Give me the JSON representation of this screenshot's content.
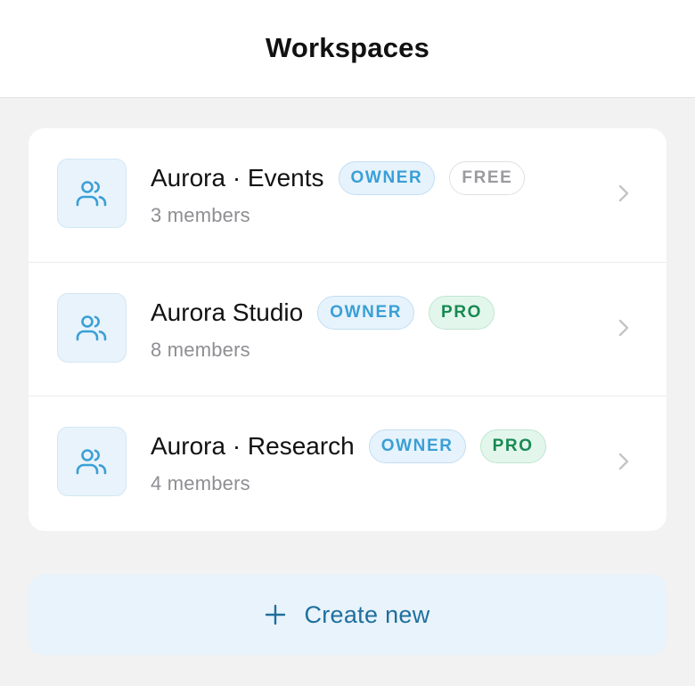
{
  "header": {
    "title": "Workspaces"
  },
  "workspaces": [
    {
      "name": "Aurora · Events",
      "members": "3 members",
      "role_badge": "OWNER",
      "plan_badge": "FREE",
      "plan_kind": "free",
      "icon": "users-icon"
    },
    {
      "name": "Aurora Studio",
      "members": "8 members",
      "role_badge": "OWNER",
      "plan_badge": "PRO",
      "plan_kind": "pro",
      "icon": "users-icon"
    },
    {
      "name": "Aurora · Research",
      "members": "4 members",
      "role_badge": "OWNER",
      "plan_badge": "PRO",
      "plan_kind": "pro",
      "icon": "users-icon"
    }
  ],
  "actions": {
    "create_label": "Create new",
    "create_icon": "plus-icon"
  },
  "colors": {
    "accent": "#3a9fd6",
    "create_text": "#1f6f9e",
    "pro": "#178a52",
    "free": "#9a9a9f",
    "background": "#f2f2f3"
  }
}
